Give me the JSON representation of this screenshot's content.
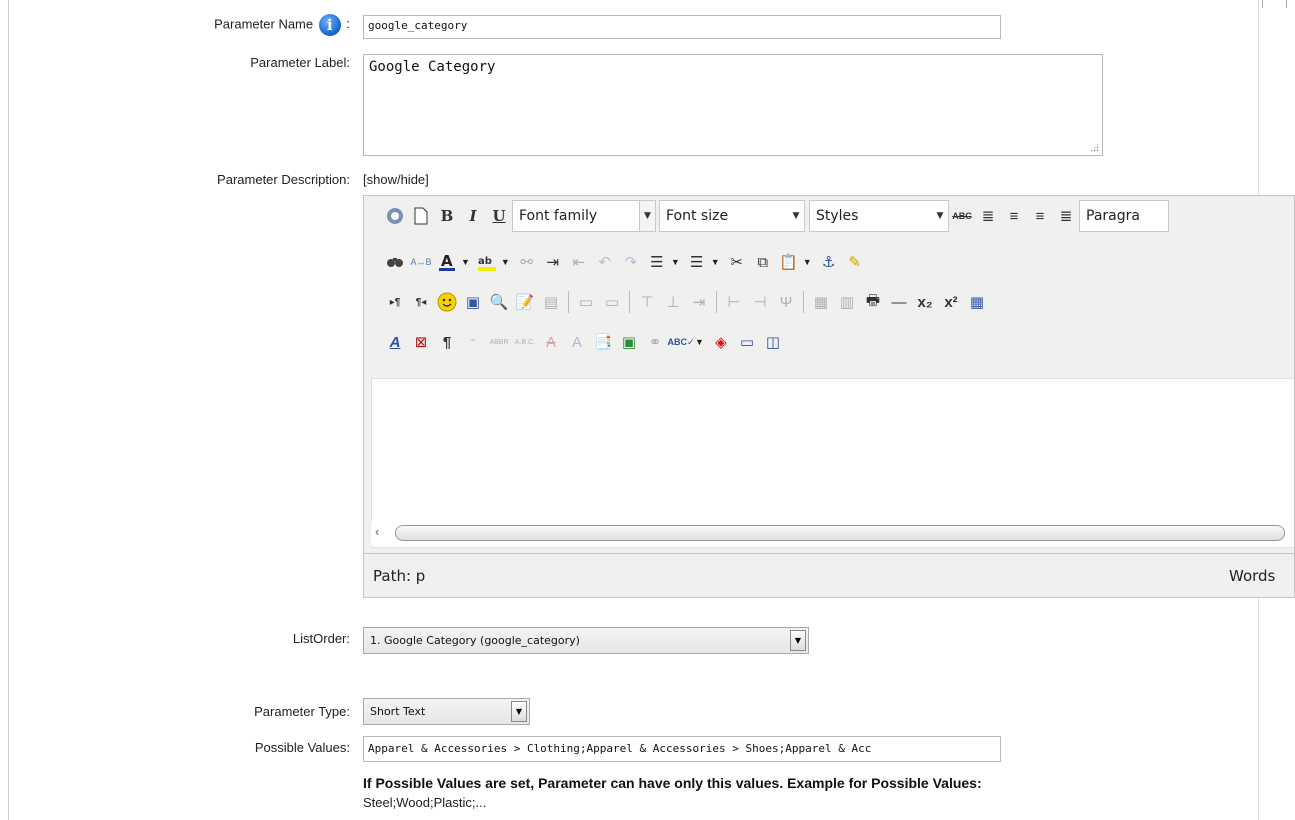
{
  "form": {
    "param_name_label": "Parameter Name",
    "param_name_colon": ":",
    "param_name_value": "google_category",
    "param_label_label": "Parameter Label:",
    "param_label_value": "Google Category",
    "param_desc_label": "Parameter Description:",
    "param_desc_toggle": "[show/hide]",
    "listorder_label": "ListOrder:",
    "listorder_value": "1. Google Category (google_category)",
    "param_type_label": "Parameter Type:",
    "param_type_value": "Short Text",
    "possible_values_label": "Possible Values:",
    "possible_values_value": "Apparel & Accessories > Clothing;Apparel & Accessories > Shoes;Apparel & Acc",
    "note_bold": "If Possible Values are set, Parameter can have only this values. Example for Possible Values:",
    "note_example": "Steel;Wood;Plastic;..."
  },
  "editor": {
    "font_family": "Font family",
    "font_size": "Font size",
    "styles": "Styles",
    "paragraph": "Paragra",
    "path": "Path: p",
    "words": "Words"
  },
  "icons": {
    "info": "info-icon"
  }
}
